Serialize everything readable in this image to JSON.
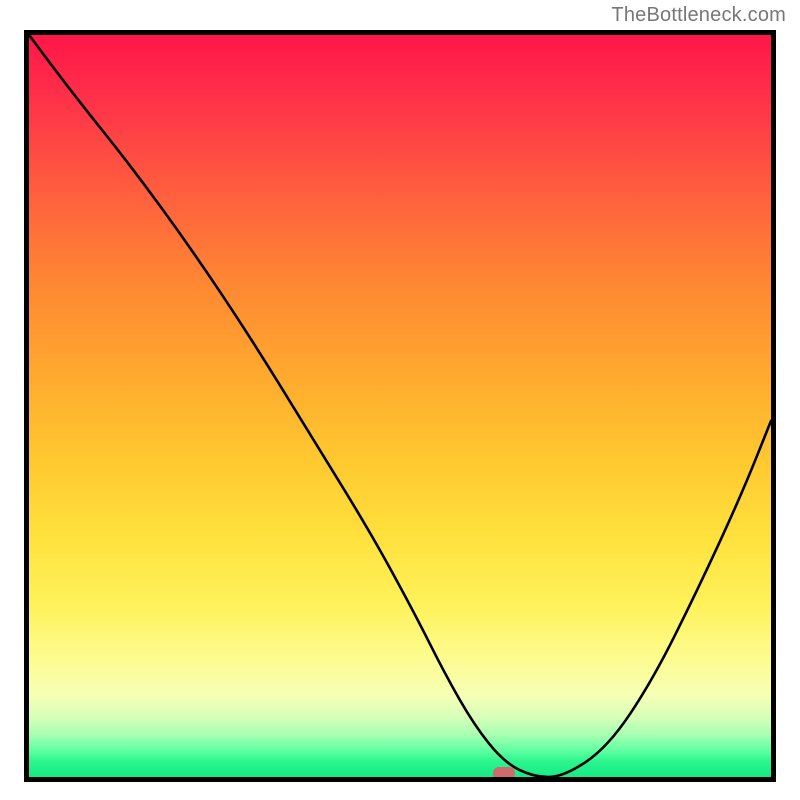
{
  "watermark": "TheBottleneck.com",
  "chart_data": {
    "type": "line",
    "title": "",
    "xlabel": "",
    "ylabel": "",
    "xlim": [
      0,
      100
    ],
    "ylim": [
      0,
      100
    ],
    "x": [
      0,
      6,
      14,
      22,
      30,
      38,
      46,
      52,
      56,
      60,
      64,
      68,
      72,
      78,
      84,
      90,
      96,
      100
    ],
    "values": [
      100,
      92,
      82,
      71,
      59,
      46,
      33,
      22,
      14,
      7,
      2,
      0,
      0,
      4,
      13,
      25,
      38,
      48
    ],
    "marker": {
      "x": 64,
      "y": 0
    },
    "background": {
      "type": "vertical_gradient",
      "stops": [
        {
          "pos": 0.0,
          "color": "#ff1648"
        },
        {
          "pos": 0.5,
          "color": "#ffbd30"
        },
        {
          "pos": 0.85,
          "color": "#fcff9e"
        },
        {
          "pos": 1.0,
          "color": "#17eb84"
        }
      ]
    }
  }
}
